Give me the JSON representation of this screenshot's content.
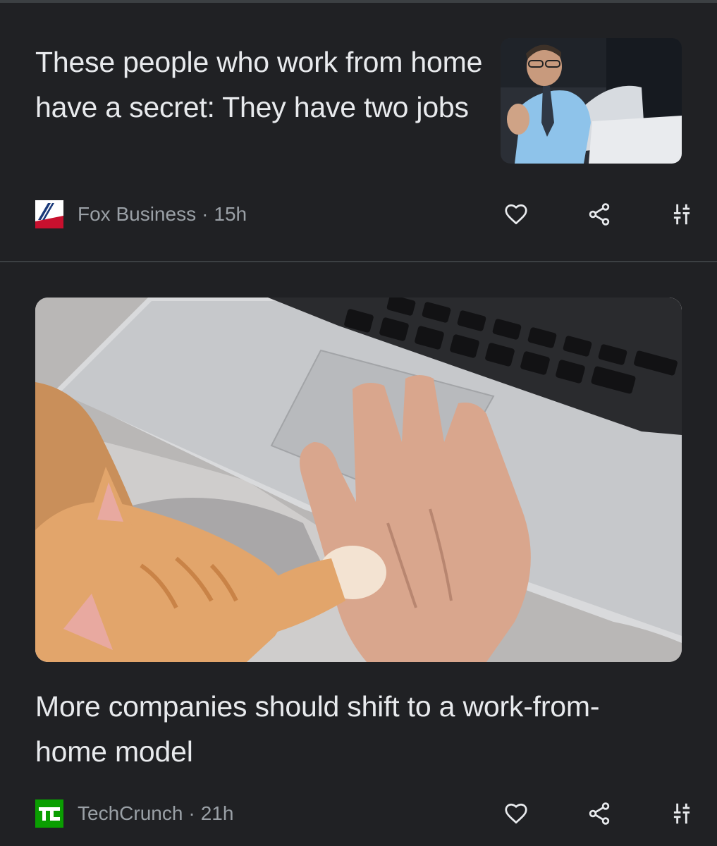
{
  "feed": {
    "articles": [
      {
        "title": "These people who work from home have a secret: They have two jobs",
        "source": "Fox Business",
        "separator": "·",
        "age": "15h",
        "image_alt": "Man in blue shirt and tie on a video call"
      },
      {
        "title": "More companies should shift to a work-from-home model",
        "source": "TechCrunch",
        "separator": "·",
        "age": "21h",
        "image_alt": "Hand on laptop trackpad next to an orange kitten"
      }
    ]
  },
  "icons": {
    "like": "heart-outline-icon",
    "share": "share-icon",
    "tune": "tune-sliders-icon"
  },
  "colors": {
    "background": "#202124",
    "title_text": "#e8eaed",
    "meta_text": "#9aa0a6",
    "divider": "#3c4043",
    "fox_red": "#c8102e",
    "fox_blue": "#1a3a7a",
    "techcrunch_green": "#0a9e01"
  }
}
